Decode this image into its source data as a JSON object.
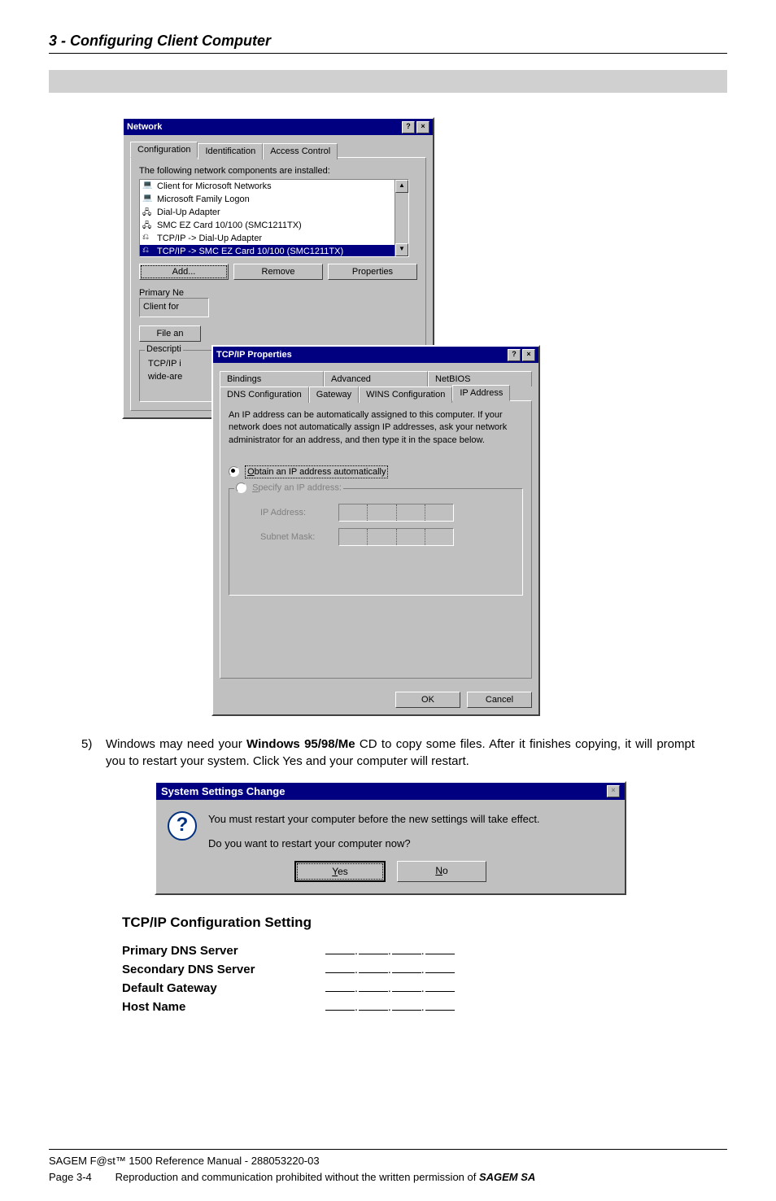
{
  "chapter": "3 - Configuring Client Computer",
  "network_dialog": {
    "title": "Network",
    "tabs": [
      "Configuration",
      "Identification",
      "Access Control"
    ],
    "components_label": "The following network components are installed:",
    "components": [
      "Client for Microsoft Networks",
      "Microsoft Family Logon",
      "Dial-Up Adapter",
      "SMC EZ Card 10/100 (SMC1211TX)",
      "TCP/IP -> Dial-Up Adapter",
      "TCP/IP -> SMC EZ Card 10/100 (SMC1211TX)"
    ],
    "buttons": {
      "add": "Add...",
      "remove": "Remove",
      "properties": "Properties"
    },
    "primary_label_truncated": "Primary Ne",
    "client_for_label": "Client for",
    "file_and_label": "File an",
    "desc_box_title": "Descripti",
    "desc_box_line1": "TCP/IP i",
    "desc_box_line2": "wide-are"
  },
  "tcpip_dialog": {
    "title": "TCP/IP Properties",
    "tabs_row1": [
      "Bindings",
      "Advanced",
      "NetBIOS"
    ],
    "tabs_row2": [
      "DNS Configuration",
      "Gateway",
      "WINS Configuration",
      "IP Address"
    ],
    "info_text": "An IP address can be automatically assigned to this computer. If your network does not automatically assign IP addresses, ask your network administrator for an address, and then type it in the space below.",
    "radio_obtain": "Obtain an IP address automatically",
    "radio_specify": "Specify an IP address:",
    "ip_label": "IP Address:",
    "mask_label": "Subnet Mask:",
    "ok": "OK",
    "cancel": "Cancel"
  },
  "step5": {
    "num": "5)",
    "text_prefix": "Windows may need your ",
    "text_bold": "Windows 95/98/Me",
    "text_suffix": " CD to copy some files. After it finishes copying, it will prompt you to restart your system. Click Yes and your computer will restart."
  },
  "msgbox": {
    "title": "System Settings Change",
    "line1": "You must restart your computer before the new settings will take effect.",
    "line2": "Do you want to restart your computer now?",
    "yes": "Yes",
    "no": "No"
  },
  "tcp_section": {
    "title": "TCP/IP Configuration Setting",
    "rows": [
      "Primary DNS Server",
      "Secondary DNS Server",
      "Default Gateway",
      "Host Name"
    ]
  },
  "footer": {
    "line1": "SAGEM F@st™ 1500 Reference Manual - 288053220-03",
    "page_label": "Page 3-4",
    "repro_prefix": "Reproduction and communication prohibited without the written permission of ",
    "sagem_bold": "SAGEM SA"
  }
}
